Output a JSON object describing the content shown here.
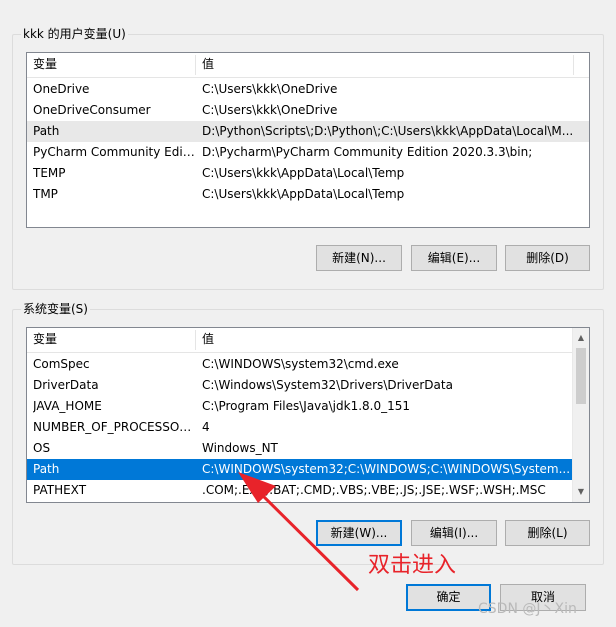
{
  "user_vars": {
    "title": "kkk 的用户变量(U)",
    "header": {
      "variable": "变量",
      "value": "值"
    },
    "rows": [
      {
        "name": "OneDrive",
        "value": "C:\\Users\\kkk\\OneDrive"
      },
      {
        "name": "OneDriveConsumer",
        "value": "C:\\Users\\kkk\\OneDrive"
      },
      {
        "name": "Path",
        "value": "D:\\Python\\Scripts\\;D:\\Python\\;C:\\Users\\kkk\\AppData\\Local\\M..."
      },
      {
        "name": "PyCharm Community Editi...",
        "value": "D:\\Pycharm\\PyCharm Community Edition 2020.3.3\\bin;"
      },
      {
        "name": "TEMP",
        "value": "C:\\Users\\kkk\\AppData\\Local\\Temp"
      },
      {
        "name": "TMP",
        "value": "C:\\Users\\kkk\\AppData\\Local\\Temp"
      }
    ],
    "buttons": {
      "new": "新建(N)...",
      "edit": "编辑(E)...",
      "delete": "删除(D)"
    }
  },
  "system_vars": {
    "title": "系统变量(S)",
    "header": {
      "variable": "变量",
      "value": "值"
    },
    "rows": [
      {
        "name": "ComSpec",
        "value": "C:\\WINDOWS\\system32\\cmd.exe"
      },
      {
        "name": "DriverData",
        "value": "C:\\Windows\\System32\\Drivers\\DriverData"
      },
      {
        "name": "JAVA_HOME",
        "value": "C:\\Program Files\\Java\\jdk1.8.0_151"
      },
      {
        "name": "NUMBER_OF_PROCESSORS",
        "value": "4"
      },
      {
        "name": "OS",
        "value": "Windows_NT"
      },
      {
        "name": "Path",
        "value": "C:\\WINDOWS\\system32;C:\\WINDOWS;C:\\WINDOWS\\System..."
      },
      {
        "name": "PATHEXT",
        "value": ".COM;.EXE;.BAT;.CMD;.VBS;.VBE;.JS;.JSE;.WSF;.WSH;.MSC"
      }
    ],
    "buttons": {
      "new": "新建(W)...",
      "edit": "编辑(I)...",
      "delete": "删除(L)"
    }
  },
  "dialog_buttons": {
    "ok": "确定",
    "cancel": "取消"
  },
  "annotation": {
    "text": "双击进入",
    "color": "#e8232a"
  },
  "watermark": "CSDN @J丶Xin",
  "colors": {
    "selection": "#0078d7",
    "background": "#f0f0f0"
  }
}
